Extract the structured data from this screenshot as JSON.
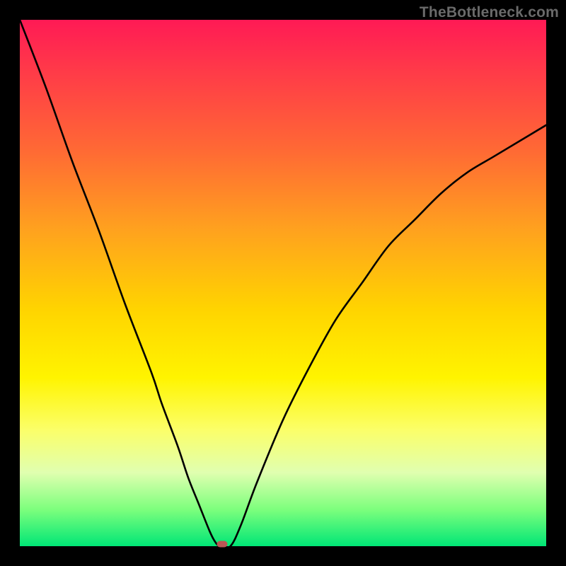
{
  "watermark": "TheBottleneck.com",
  "colors": {
    "frame": "#000000",
    "curve": "#000000",
    "marker": "#bb5555",
    "gradient_top": "#ff1a55",
    "gradient_bottom": "#00e676"
  },
  "chart_data": {
    "type": "line",
    "title": "",
    "xlabel": "",
    "ylabel": "",
    "xlim": [
      0,
      100
    ],
    "ylim": [
      0,
      100
    ],
    "grid": false,
    "legend": false,
    "series": [
      {
        "name": "bottleneck-curve",
        "x": [
          0,
          5,
          10,
          15,
          20,
          25,
          27,
          30,
          32,
          34,
          36,
          37,
          38,
          40,
          42,
          45,
          50,
          55,
          60,
          65,
          70,
          75,
          80,
          85,
          90,
          95,
          100
        ],
        "y": [
          100,
          87,
          73,
          60,
          46,
          33,
          27,
          19,
          13,
          8,
          3,
          1,
          0,
          0,
          4,
          12,
          24,
          34,
          43,
          50,
          57,
          62,
          67,
          71,
          74,
          77,
          80
        ]
      }
    ],
    "annotations": [
      {
        "name": "min-marker",
        "x": 38.5,
        "y": 0
      }
    ]
  }
}
